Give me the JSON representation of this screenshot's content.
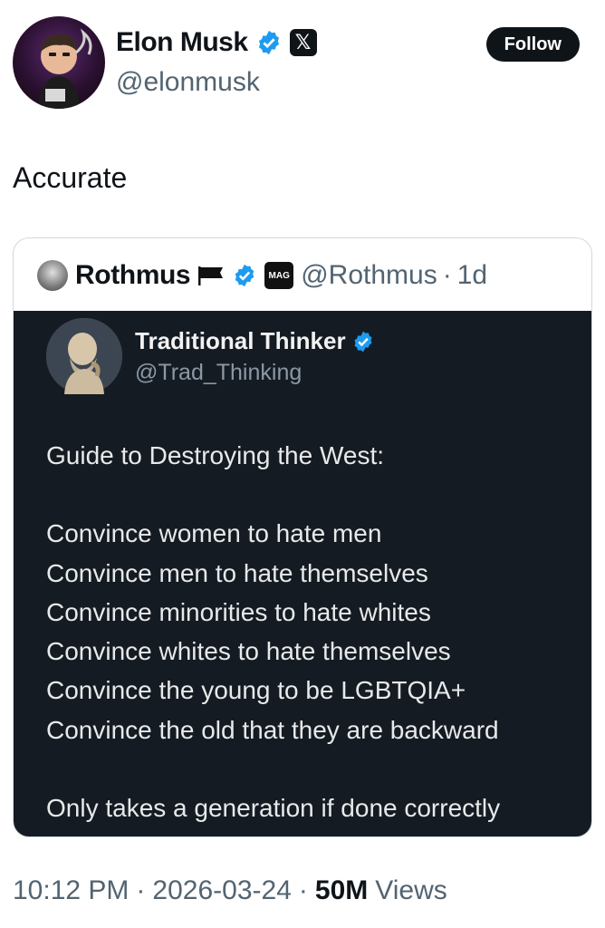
{
  "author": {
    "name": "Elon Musk",
    "handle": "@elonmusk",
    "affiliation_badge": "𝕏",
    "avatar_icon": "cartoon-avatar",
    "verified_icon": "verified-badge-icon"
  },
  "follow_label": "Follow",
  "tweet_text": "Accurate",
  "quoted": {
    "name": "Rothmus",
    "flag_icon": "black-flag-icon",
    "affiliation_badge": "MAG",
    "handle": "@Rothmus",
    "separator": "·",
    "time": "1d",
    "media": {
      "name": "Traditional Thinker",
      "handle": "@Trad_Thinking",
      "lines": [
        "Guide to Destroying the West:",
        "",
        "Convince women to hate men",
        "Convince men to hate themselves",
        "Convince minorities to hate whites",
        "Convince whites to hate themselves",
        "Convince the young to be LGBTQIA+",
        "Convince the old that they are backward",
        "",
        "Only takes a generation if done correctly"
      ]
    }
  },
  "meta": {
    "time": "10:12 PM",
    "sep1": "·",
    "date": "2026-03-24",
    "sep2": "·",
    "views_count": "50M",
    "views_label": "Views"
  },
  "colors": {
    "verified_blue": "#1d9bf0",
    "text_primary": "#0f1419",
    "text_secondary": "#536471",
    "media_bg": "#151b22"
  }
}
